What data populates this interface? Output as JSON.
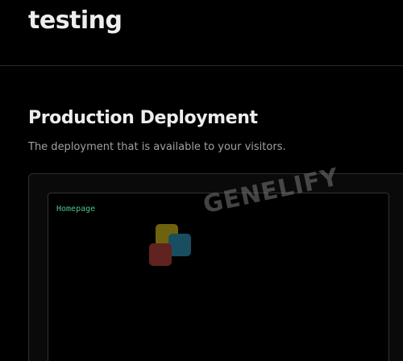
{
  "header": {
    "project_name": "testing"
  },
  "production": {
    "title": "Production Deployment",
    "description": "The deployment that is available to your visitors.",
    "preview": {
      "label": "Homepage"
    }
  },
  "watermark": {
    "text": "GENELIFY"
  },
  "colors": {
    "background": "#000000",
    "text": "#ededed",
    "muted": "#a1a1a1",
    "border": "#2e2e2e",
    "accent_green": "#4cc38a"
  }
}
